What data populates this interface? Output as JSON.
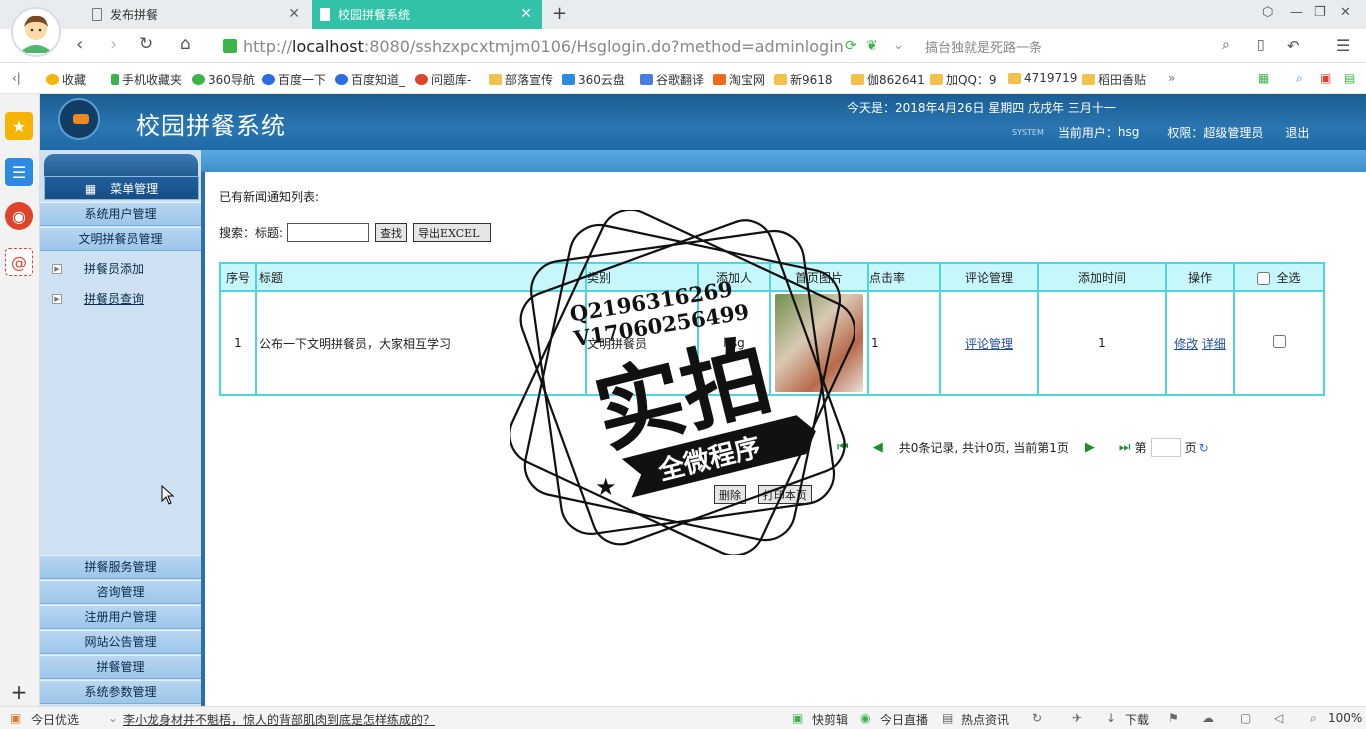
{
  "browser": {
    "tabs": [
      {
        "label": "发布拼餐",
        "active": false
      },
      {
        "label": "校园拼餐系统",
        "active": true
      }
    ],
    "url_prefix": "http://",
    "url_host": "localhost",
    "url_rest": ":8080/sshzxpcxtmjm0106/Hsglogin.do?method=adminlogin",
    "search_placeholder": "搞台独就是死路一条",
    "bookmarks": [
      "收藏",
      "手机收藏夹",
      "360导航",
      "百度一下",
      "百度知道_",
      "问题库-",
      "部落宣传",
      "360云盘",
      "谷歌翻译",
      "淘宝网",
      "新9618",
      "伽862641",
      "加QQ：9",
      "4719719",
      "稻田香贴"
    ]
  },
  "header": {
    "system_title": "校园拼餐系统",
    "today": "今天是：2018年4月26日 星期四 戊戌年 三月十一",
    "current_user_label": "当前用户：",
    "current_user": "hsg",
    "role_label": "权限：",
    "role": "超级管理员",
    "logout": "退出",
    "system_tag": "SYSTEM"
  },
  "sidebar": {
    "menu_head": "菜单管理",
    "top_items": [
      "系统用户管理",
      "文明拼餐员管理"
    ],
    "sub_items": [
      "拼餐员添加",
      "拼餐员查询"
    ],
    "bottom_items": [
      "拼餐服务管理",
      "咨询管理",
      "注册用户管理",
      "网站公告管理",
      "拼餐管理",
      "系统参数管理"
    ]
  },
  "main": {
    "notice_title": "已有新闻通知列表:",
    "search_label": "搜索：",
    "title_label": "标题:",
    "search_value": "",
    "search_button": "查找",
    "export_button": "导出EXCEL",
    "columns": [
      "序号",
      "标题",
      "类别",
      "添加人",
      "首页图片",
      "点击率",
      "评论管理",
      "添加时间",
      "操作",
      "全选"
    ],
    "rows": [
      {
        "index": "1",
        "title": "公布一下文明拼餐员，大家相互学习",
        "category": "文明拼餐员",
        "adder": "hsg",
        "clicks": "1",
        "comment_link": "评论管理",
        "added": "1",
        "edit": "修改",
        "detail": "详细"
      }
    ],
    "pager_text": "共0条记录, 共计0页, 当前第1页",
    "page_prefix": "第",
    "page_suffix": "页",
    "delete_button": "删除",
    "print_button": "打印本页"
  },
  "watermark": {
    "line1": "Q2196316269",
    "line2": "V17060256499",
    "big": "实拍",
    "ribbon": "全微程序"
  },
  "statusbar": {
    "left": "今日优选",
    "headline": "李小龙身材并不魁梧，惊人的背部肌肉到底是怎样练成的？",
    "items": [
      "快剪辑",
      "今日直播",
      "热点资讯",
      "下载"
    ],
    "zoom": "100%"
  }
}
